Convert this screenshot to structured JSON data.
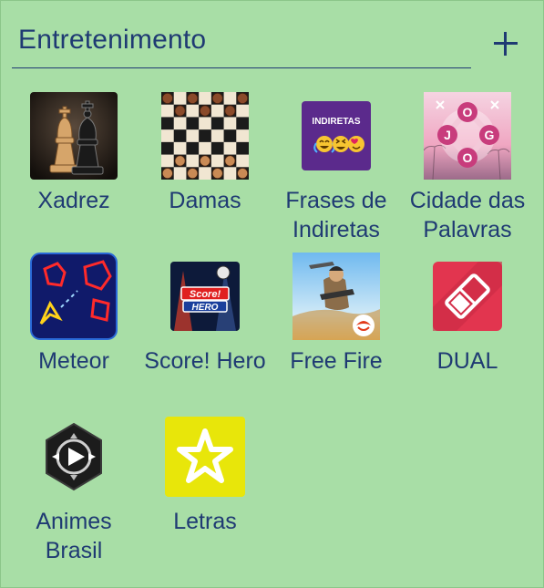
{
  "folder": {
    "title": "Entretenimento",
    "apps": [
      {
        "id": "xadrez",
        "label": "Xadrez"
      },
      {
        "id": "damas",
        "label": "Damas"
      },
      {
        "id": "frases",
        "label": "Frases de Indiretas",
        "icon_text": "INDIRETAS"
      },
      {
        "id": "cidade",
        "label": "Cidade das Palavras",
        "icon_letters": [
          "J",
          "O",
          "G",
          "O"
        ]
      },
      {
        "id": "meteor",
        "label": "Meteor"
      },
      {
        "id": "score",
        "label": "Score! Hero",
        "icon_text": [
          "Score!",
          "HERO"
        ]
      },
      {
        "id": "freefire",
        "label": "Free Fire"
      },
      {
        "id": "dual",
        "label": "DUAL"
      },
      {
        "id": "animes",
        "label": "Animes Brasil"
      },
      {
        "id": "letras",
        "label": "Letras"
      }
    ]
  }
}
